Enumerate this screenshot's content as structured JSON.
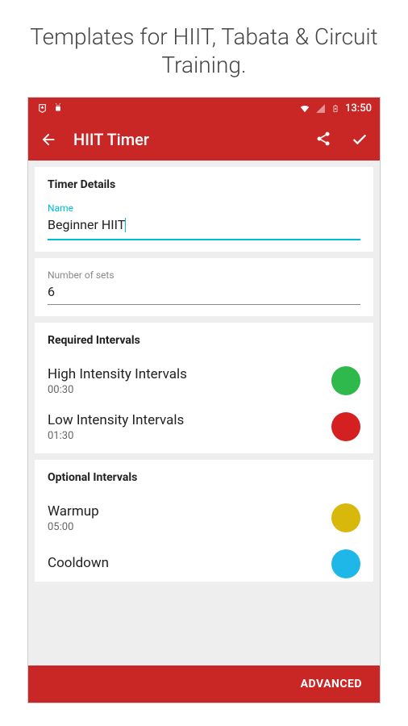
{
  "promo": "Templates for HIIT, Tabata & Circuit Training.",
  "status": {
    "time": "13:50"
  },
  "appbar": {
    "title": "HIIT Timer"
  },
  "details": {
    "section": "Timer Details",
    "name_label": "Name",
    "name_value": "Beginner HIIT",
    "sets_label": "Number of sets",
    "sets_value": "6"
  },
  "required": {
    "section": "Required Intervals",
    "items": [
      {
        "name": "High Intensity Intervals",
        "time": "00:30",
        "color": "#2fb84c"
      },
      {
        "name": "Low Intensity Intervals",
        "time": "01:30",
        "color": "#d42020"
      }
    ]
  },
  "optional": {
    "section": "Optional Intervals",
    "items": [
      {
        "name": "Warmup",
        "time": "05:00",
        "color": "#d9b80c"
      },
      {
        "name": "Cooldown",
        "time": "",
        "color": "#1fb6e8"
      }
    ]
  },
  "footer": {
    "advanced": "ADVANCED"
  }
}
